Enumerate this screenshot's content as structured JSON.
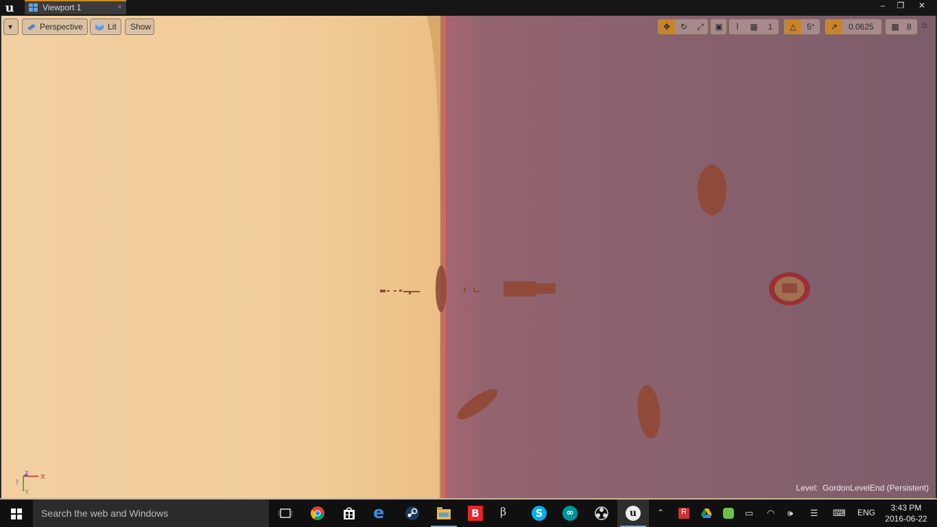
{
  "window": {
    "tab_label": "Viewport 1",
    "tab_close": "×",
    "minimize": "–",
    "restore": "❐",
    "close": "✕"
  },
  "viewport": {
    "menu_arrow": "▾",
    "perspective_label": "Perspective",
    "lit_label": "Lit",
    "show_label": "Show",
    "grid_snap_value": "1",
    "rotation_snap_value": "5°",
    "scale_snap_value": "0.0625",
    "camera_speed_value": "8",
    "level_prefix": "Level:",
    "level_name": "GordonLevelEnd (Persistent)",
    "axis_x": "X",
    "axis_y": "Y",
    "axis_z": "Z",
    "colors": {
      "sky_left": "#f0c893",
      "sky_right": "#8a5e72",
      "horizon": "#b25a5a",
      "objects": "#8f4a3a",
      "active": "#c8842a"
    }
  },
  "taskbar": {
    "search_placeholder": "Search the web and Windows",
    "apps": [
      "task-view",
      "chrome",
      "store",
      "edge",
      "steam",
      "file-explorer",
      "bitdefender",
      "beta-app",
      "skype",
      "arduino",
      "obs",
      "unreal-engine"
    ],
    "language": "ENG",
    "time": "3:43 PM",
    "date": "2016-06-22"
  }
}
